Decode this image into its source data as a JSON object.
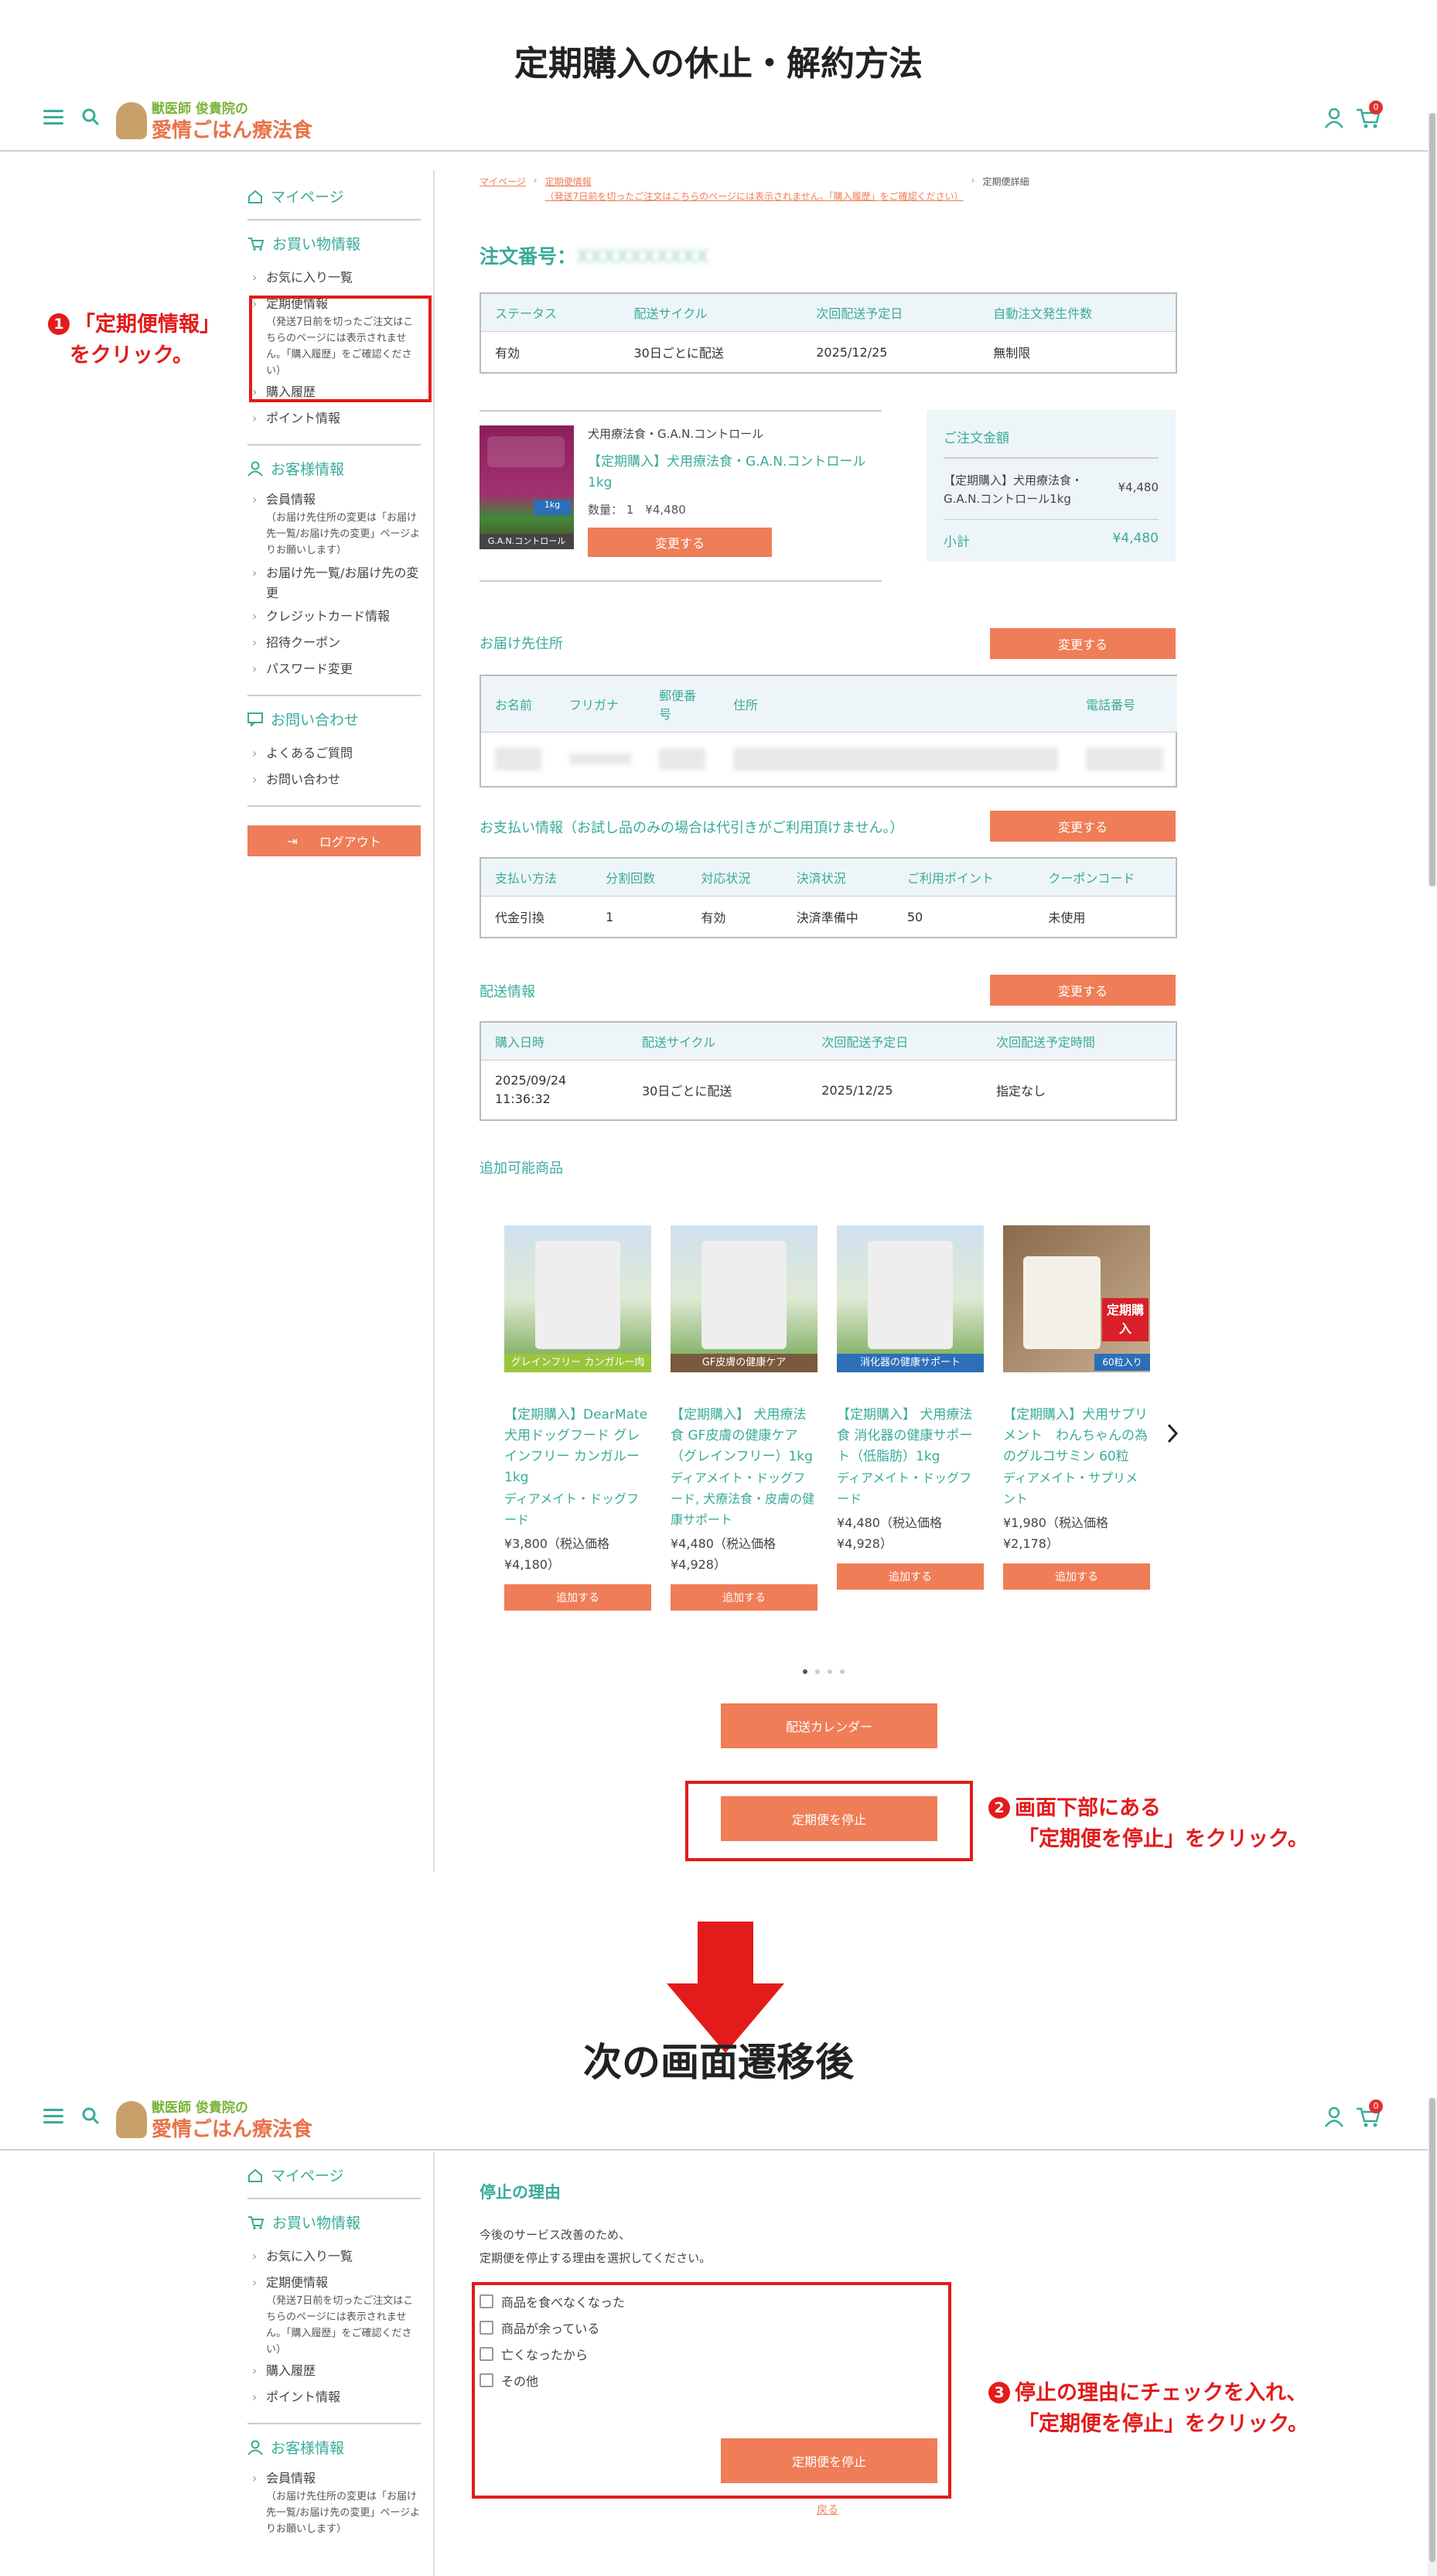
{
  "page_title": "定期購入の休止・解約方法",
  "second_title": "次の画面遷移後",
  "colors": {
    "accent": "#3aab98",
    "button": "#ef7d57",
    "annotation": "#e31b1b"
  },
  "header": {
    "logo_top": "獣医師 俊貴院の",
    "logo_main": "愛情ごはん療法食",
    "cart_count": "0"
  },
  "sidebar": {
    "mypage": "マイページ",
    "shopping_head": "お買い物情報",
    "favorites": "お気に入り一覧",
    "teiki": "定期便情報",
    "teiki_note": "（発送7日前を切ったご注文はこちらのページには表示されません。「購入履歴」をご確認ください）",
    "history": "購入履歴",
    "points": "ポイント情報",
    "customer_head": "お客様情報",
    "member": "会員情報",
    "member_note": "（お届け先住所の変更は「お届け先一覧/お届け先の変更」ページよりお願いします）",
    "address": "お届け先一覧/お届け先の変更",
    "card": "クレジットカード情報",
    "coupon": "招待クーポン",
    "password": "パスワード変更",
    "contact_head": "お問い合わせ",
    "faq": "よくあるご質問",
    "inquiry": "お問い合わせ",
    "logout": "ログアウト"
  },
  "breadcrumb": {
    "mypage": "マイページ",
    "teiki": "定期便情報",
    "teiki_note": "（発送7日前を切ったご注文はこちらのページには表示されません。「購入履歴」をご確認ください）",
    "detail": "定期便詳細"
  },
  "order": {
    "title": "注文番号：",
    "headers": [
      "ステータス",
      "配送サイクル",
      "次回配送予定日",
      "自動注文発生件数"
    ],
    "row": [
      "有効",
      "30日ごとに配送",
      "2025/12/25",
      "無制限"
    ]
  },
  "product": {
    "brand": "犬用療法食・G.A.N.コントロール",
    "name": "【定期購入】犬用療法食・G.A.N.コントロール1kg",
    "qty": "数量： 1　¥4,480",
    "change": "変更する",
    "img_label": "G.A.N.コントロール",
    "img_weight": "1kg"
  },
  "summary": {
    "title": "ご注文金額",
    "item": "【定期購入】犬用療法食・G.A.N.コントロール1kg",
    "item_price": "¥4,480",
    "subtotal_label": "小計",
    "subtotal": "¥4,480"
  },
  "delivery": {
    "title": "お届け先住所",
    "change": "変更する",
    "headers": [
      "お名前",
      "フリガナ",
      "郵便番号",
      "住所",
      "電話番号"
    ]
  },
  "payment": {
    "title": "お支払い情報（お試し品のみの場合は代引きがご利用頂けません。）",
    "change": "変更する",
    "headers": [
      "支払い方法",
      "分割回数",
      "対応状況",
      "決済状況",
      "ご利用ポイント",
      "クーポンコード"
    ],
    "row": [
      "代金引換",
      "1",
      "有効",
      "決済準備中",
      "50",
      "未使用"
    ]
  },
  "shipping": {
    "title": "配送情報",
    "change": "変更する",
    "headers": [
      "購入日時",
      "配送サイクル",
      "次回配送予定日",
      "次回配送予定時間"
    ],
    "row": [
      "2025/09/24 11:36:32",
      "30日ごとに配送",
      "2025/12/25",
      "指定なし"
    ]
  },
  "addable": {
    "title": "追加可能商品",
    "add": "追加する",
    "items": [
      {
        "name": "【定期購入】DearMate 犬用ドッグフード グレインフリー カンガルー 1kg",
        "cat": "ディアメイト・ドッグフード",
        "price": "¥3,800（税込価格 ¥4,180）",
        "band": "グレインフリー カンガルー肉"
      },
      {
        "name": "【定期購入】 犬用療法食 GF皮膚の健康ケア（グレインフリー）1kg",
        "cat": "ディアメイト・ドッグフード, 犬療法食・皮膚の健康サポート",
        "price": "¥4,480（税込価格 ¥4,928）",
        "band": "GF皮膚の健康ケア"
      },
      {
        "name": "【定期購入】 犬用療法食 消化器の健康サポート（低脂肪）1kg",
        "cat": "ディアメイト・ドッグフード",
        "price": "¥4,480（税込価格 ¥4,928）",
        "band": "消化器の健康サポート"
      },
      {
        "name": "【定期購入】犬用サプリメント　わんちゃんの為のグルコサミン 60粒",
        "cat": "ディアメイト・サプリメント",
        "price": "¥1,980（税込価格 ¥2,178）",
        "band": "60粒入り",
        "tag": "定期購入"
      }
    ]
  },
  "calendar_btn": "配送カレンダー",
  "stop_btn": "定期便を停止",
  "annotations": {
    "a1_num": "1",
    "a1_l1": "「定期便情報」",
    "a1_l2": "をクリック。",
    "a2_num": "2",
    "a2_l1": "画面下部にある",
    "a2_l2": "「定期便を停止」をクリック。",
    "a3_num": "3",
    "a3_l1": "停止の理由にチェックを入れ、",
    "a3_l2": "「定期便を停止」をクリック。"
  },
  "stop_page": {
    "title": "停止の理由",
    "desc1": "今後のサービス改善のため、",
    "desc2": "定期便を停止する理由を選択してください。",
    "reasons": [
      "商品を食べなくなった",
      "商品が余っている",
      "亡くなったから",
      "その他"
    ],
    "stop_btn": "定期便を停止",
    "back": "戻る"
  }
}
